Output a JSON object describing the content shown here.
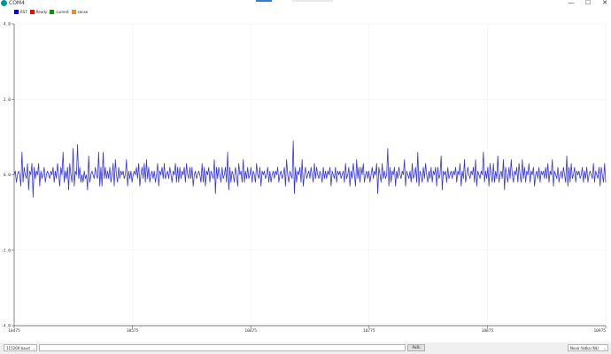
{
  "window": {
    "title": "COM4",
    "controls": {
      "minimize": "—",
      "maximize": "☐",
      "close": "✕"
    }
  },
  "legend": [
    {
      "label": "RST",
      "color": "#0000ff"
    },
    {
      "label": "Ready",
      "color": "#ff0000"
    },
    {
      "label": "current",
      "color": "#009900"
    },
    {
      "label": "sense",
      "color": "#ff8c00"
    }
  ],
  "chart_data": {
    "type": "line",
    "ylim": [
      -4.0,
      4.0
    ],
    "yticks": [
      {
        "value": 4.0,
        "label": "4.0"
      },
      {
        "value": 2.0,
        "label": "2.0"
      },
      {
        "value": 0.0,
        "label": "0.0"
      },
      {
        "value": -2.0,
        "label": "-2.0"
      },
      {
        "value": -4.0,
        "label": "-4.0"
      }
    ],
    "xticks": [
      {
        "value": 10475,
        "label": "10475"
      },
      {
        "value": 10575,
        "label": "10575"
      },
      {
        "value": 10675,
        "label": "10675"
      },
      {
        "value": 10775,
        "label": "10775"
      },
      {
        "value": 10875,
        "label": "10875"
      },
      {
        "value": 10975,
        "label": "10975"
      }
    ],
    "xlim": [
      10475,
      10975
    ],
    "series": [
      {
        "color": "#3333ee",
        "y": [
          0.0,
          0.1,
          -0.2,
          0.0,
          0.1,
          0.0,
          -0.3,
          0.6,
          -0.2,
          0.2,
          0.0,
          -0.1,
          0.3,
          -0.4,
          0.1,
          0.0,
          0.3,
          -0.6,
          0.2,
          -0.1,
          0.1,
          0.0,
          0.3,
          -0.3,
          0.1,
          -0.1,
          0.0,
          0.2,
          -0.2,
          0.0,
          0.1,
          0.0,
          -0.1,
          0.1,
          0.0,
          0.2,
          -0.2,
          0.1,
          -0.1,
          0.3,
          0.0,
          -0.3,
          0.2,
          0.0,
          0.6,
          -0.2,
          0.1,
          -0.1,
          0.2,
          -0.4,
          0.3,
          0.0,
          -0.2,
          0.7,
          -0.3,
          0.1,
          0.0,
          0.8,
          -0.1,
          0.2,
          -0.2,
          0.0,
          -0.2,
          0.1,
          -0.1,
          0.0,
          -0.4,
          0.5,
          -0.2,
          0.0,
          0.1,
          0.0,
          -0.1,
          0.2,
          0.0,
          -0.1,
          0.6,
          -0.3,
          0.2,
          -0.3,
          0.6,
          -0.1,
          0.2,
          -0.1,
          0.1,
          -0.1,
          0.2,
          -0.2,
          0.0,
          0.3,
          -0.3,
          0.4,
          0.0,
          -0.2,
          0.2,
          -0.1,
          0.1,
          0.0,
          0.1,
          -0.1,
          0.0,
          0.4,
          -0.3,
          0.1,
          -0.1,
          0.1,
          -0.2,
          0.0,
          0.1,
          0.0,
          0.2,
          -0.1,
          0.3,
          -0.3,
          0.0,
          0.2,
          -0.1,
          0.3,
          -0.2,
          0.4,
          -0.1,
          0.2,
          -0.2,
          0.0,
          0.1,
          -0.1,
          0.1,
          -0.2,
          0.0,
          0.3,
          -0.3,
          0.1,
          0.0,
          0.2,
          -0.1,
          0.3,
          -0.1,
          0.0,
          0.1,
          -0.1,
          0.2,
          0.0,
          -0.2,
          0.1,
          0.0,
          0.3,
          -0.2,
          0.2,
          -0.2,
          0.2,
          -0.1,
          0.1,
          0.0,
          0.2,
          -0.2,
          0.3,
          0.0,
          -0.1,
          0.2,
          -0.1,
          0.2,
          -0.3,
          0.0,
          0.1,
          -0.1,
          0.0,
          0.1,
          0.0,
          -0.2,
          0.3,
          -0.2,
          0.2,
          -0.3,
          0.1,
          0.0,
          0.2,
          -0.2,
          0.1,
          0.0,
          -0.1,
          0.4,
          -0.5,
          0.2,
          -0.1,
          0.2,
          0.0,
          -0.2,
          0.2,
          -0.1,
          0.0,
          0.2,
          -0.2,
          0.6,
          -0.4,
          0.2,
          -0.2,
          0.1,
          0.0,
          -0.2,
          0.2,
          0.0,
          -0.3,
          0.3,
          0.0,
          0.1,
          -0.2,
          0.4,
          -0.2,
          0.1,
          -0.1,
          0.2,
          -0.1,
          0.0,
          0.2,
          -0.2,
          0.1,
          0.0,
          -0.2,
          0.3,
          0.0,
          -0.1,
          0.2,
          -0.3,
          0.1,
          0.0,
          0.1,
          -0.1,
          0.0,
          0.2,
          -0.2,
          0.1,
          -0.2,
          0.0,
          0.1,
          -0.1,
          0.1,
          0.0,
          0.2,
          -0.2,
          0.0,
          0.1,
          -0.1,
          0.0,
          0.2,
          -0.3,
          0.4,
          0.0,
          -0.2,
          0.1,
          0.0,
          -0.1,
          0.9,
          -0.5,
          0.2,
          -0.2,
          0.1,
          0.0,
          0.2,
          -0.2,
          0.4,
          -0.3,
          0.0,
          0.2,
          -0.1,
          0.0,
          0.1,
          -0.1,
          0.2,
          0.0,
          -0.2,
          0.3,
          -0.1,
          0.2,
          0.0,
          -0.1,
          0.1,
          0.0,
          -0.2,
          0.2,
          -0.1,
          0.1,
          -0.1,
          0.1,
          0.0,
          0.2,
          -0.3,
          0.1,
          0.0,
          -0.1,
          0.2,
          -0.2,
          0.1,
          0.0,
          0.1,
          -0.1,
          0.0,
          0.1,
          -0.2,
          0.3,
          -0.1,
          0.0,
          0.2,
          -0.3,
          0.1,
          -0.1,
          0.3,
          0.0,
          -0.3,
          0.4,
          -0.1,
          0.2,
          -0.2,
          0.2,
          0.0,
          0.3,
          -0.2,
          0.0,
          0.1,
          -0.1,
          0.1,
          -0.2,
          0.0,
          0.2,
          -0.1,
          0.1,
          0.0,
          0.3,
          -0.5,
          0.2,
          0.0,
          -0.2,
          0.3,
          -0.1,
          0.1,
          -0.1,
          0.0,
          0.7,
          -0.3,
          0.2,
          -0.2,
          0.1,
          0.0,
          0.2,
          -0.3,
          0.1,
          -0.1,
          0.2,
          0.0,
          -0.1,
          0.1,
          0.0,
          0.4,
          -0.3,
          0.1,
          0.0,
          -0.1,
          0.1,
          -0.2,
          0.3,
          -0.1,
          0.0,
          0.2,
          -0.2,
          0.6,
          -0.3,
          0.1,
          0.0,
          -0.2,
          0.2,
          -0.1,
          0.3,
          0.0,
          -0.2,
          0.1,
          -0.1,
          0.2,
          -0.2,
          0.1,
          0.0,
          0.2,
          -0.3,
          0.2,
          -0.1,
          0.0,
          0.5,
          -0.4,
          0.1,
          0.0,
          0.1,
          -0.2,
          0.2,
          -0.1,
          0.0,
          0.1,
          -0.1,
          0.1,
          0.0,
          0.2,
          -0.2,
          0.1,
          0.0,
          0.3,
          -0.3,
          0.1,
          -0.1,
          0.4,
          -0.2,
          0.0,
          0.2,
          0.0,
          -0.1,
          0.1,
          0.0,
          0.2,
          -0.2,
          0.4,
          -0.3,
          0.1,
          0.0,
          -0.1,
          0.1,
          0.0,
          0.6,
          -0.2,
          0.1,
          -0.1,
          0.2,
          -0.3,
          0.3,
          0.0,
          -0.2,
          0.3,
          -0.2,
          0.1,
          -0.1,
          0.5,
          -0.2,
          0.0,
          0.1,
          -0.1,
          0.4,
          -0.4,
          0.2,
          0.0,
          -0.2,
          0.2,
          -0.1,
          0.4,
          0.0,
          -0.2,
          0.1,
          0.0,
          0.2,
          -0.2,
          0.3,
          0.0,
          -0.2,
          0.4,
          -0.1,
          0.2,
          -0.2,
          0.1,
          0.0,
          0.3,
          -0.2,
          0.1,
          0.0,
          0.2,
          -0.3,
          0.0,
          0.1,
          -0.1,
          0.2,
          -0.2,
          0.1,
          0.0,
          0.1,
          -0.1,
          0.2,
          -0.1,
          0.3,
          -0.2,
          0.1,
          0.0,
          0.4,
          -0.3,
          0.1,
          0.0,
          -0.1,
          0.2,
          -0.2,
          0.0,
          0.1,
          -0.1,
          0.2,
          0.0,
          -0.2,
          0.5,
          -0.3,
          0.2,
          -0.2,
          0.3,
          -0.1,
          0.0,
          0.2,
          -0.2,
          0.1,
          0.0,
          0.1,
          -0.1,
          0.0,
          0.2,
          -0.2,
          0.1,
          -0.1,
          0.2,
          -0.2,
          0.0,
          0.1,
          0.0,
          -0.1,
          0.3,
          -0.2,
          0.1,
          0.0,
          -0.1,
          0.2,
          -0.3,
          0.2,
          0.0,
          -0.2,
          0.3,
          -0.2
        ]
      }
    ]
  },
  "bottom": {
    "baud": "115200 baud",
    "send_input_value": "",
    "send_label": "Pošli",
    "line_ending": "Nová řádka (NL)"
  }
}
